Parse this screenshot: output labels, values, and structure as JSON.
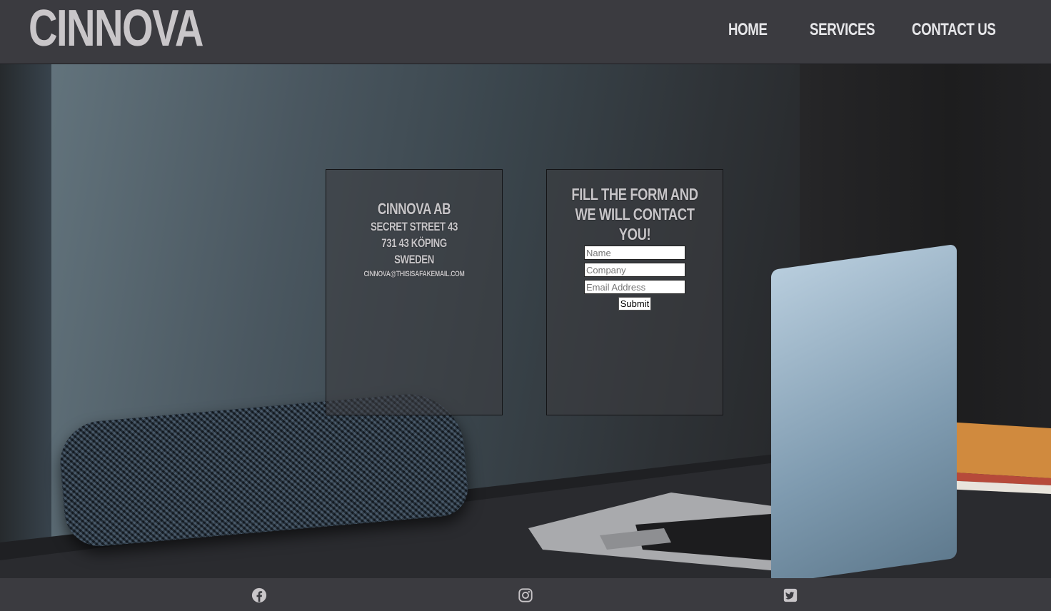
{
  "header": {
    "logo": "CINNOVA",
    "nav": {
      "home": "HOME",
      "services": "SERVICES",
      "contact": "CONTACT US"
    }
  },
  "address_card": {
    "company": "CINNOVA AB",
    "street": "SECRET STREET 43",
    "city": "731 43 KÖPING",
    "country": "SWEDEN",
    "email": "CINNOVA@THISISAFAKEMAIL.COM"
  },
  "contact_form": {
    "title": "FILL THE FORM AND WE WILL CONTACT YOU!",
    "name_placeholder": "Name",
    "company_placeholder": "Company",
    "email_placeholder": "Email Address",
    "submit_label": "Submit"
  },
  "footer": {
    "icons": [
      "facebook-icon",
      "instagram-icon",
      "twitter-icon"
    ]
  },
  "colors": {
    "header_bg": "#3b3b40",
    "text_light": "#c9c6c9",
    "nav_text": "#e6e6e9"
  }
}
